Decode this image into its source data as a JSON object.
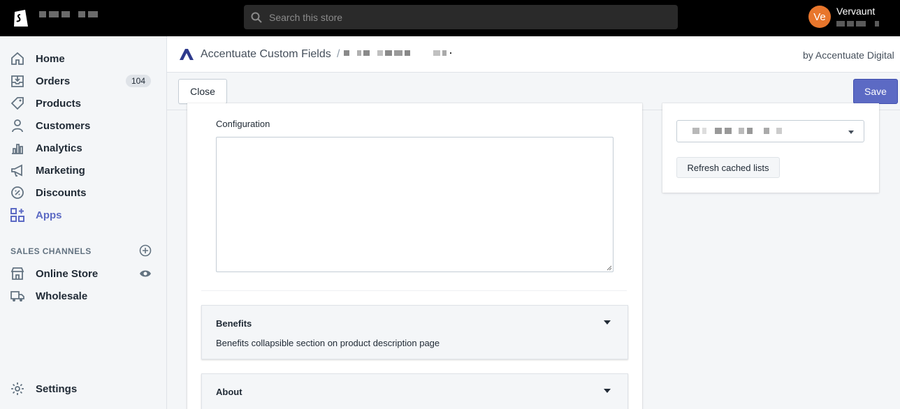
{
  "topbar": {
    "search_placeholder": "Search this store",
    "user_initials": "Ve",
    "user_name": "Vervaunt"
  },
  "sidebar": {
    "items": [
      {
        "label": "Home",
        "icon": "home-icon"
      },
      {
        "label": "Orders",
        "icon": "orders-icon",
        "badge": "104"
      },
      {
        "label": "Products",
        "icon": "tag-icon"
      },
      {
        "label": "Customers",
        "icon": "person-icon"
      },
      {
        "label": "Analytics",
        "icon": "bar-chart-icon"
      },
      {
        "label": "Marketing",
        "icon": "megaphone-icon"
      },
      {
        "label": "Discounts",
        "icon": "discount-icon"
      },
      {
        "label": "Apps",
        "icon": "apps-icon",
        "active": true
      }
    ],
    "sales_channels_title": "SALES CHANNELS",
    "channels": [
      {
        "label": "Online Store",
        "icon": "store-icon"
      },
      {
        "label": "Wholesale",
        "icon": "truck-icon"
      }
    ],
    "settings_label": "Settings"
  },
  "app_header": {
    "app_name": "Accentuate Custom Fields",
    "separator": "/",
    "by_text": "by Accentuate Digital"
  },
  "action_bar": {
    "close_label": "Close",
    "save_label": "Save"
  },
  "main": {
    "configuration_label": "Configuration",
    "configuration_value": "",
    "sections": [
      {
        "title": "Benefits",
        "description": "Benefits collapsible section on product description page"
      },
      {
        "title": "About",
        "description": ""
      }
    ]
  },
  "right_panel": {
    "refresh_label": "Refresh cached lists"
  },
  "colors": {
    "accent": "#5c6ac4",
    "avatar": "#e8762c",
    "topbar": "#000000"
  }
}
